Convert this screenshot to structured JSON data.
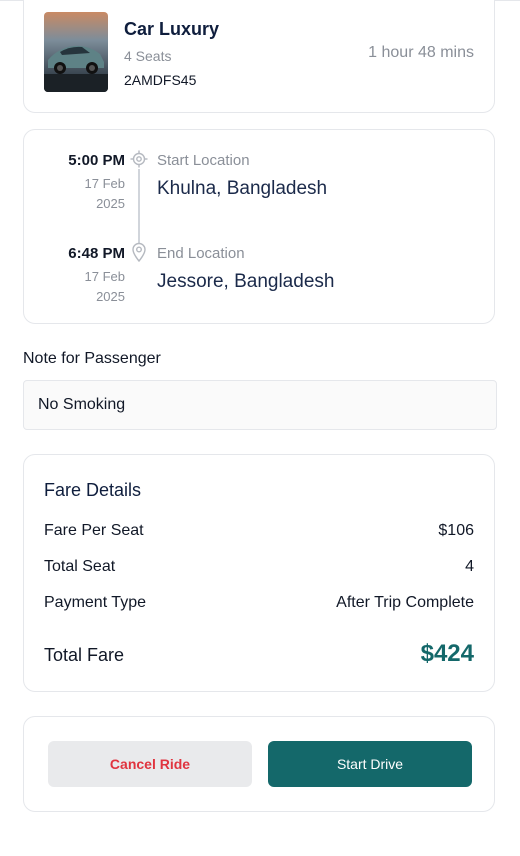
{
  "vehicle": {
    "name": "Car Luxury",
    "seats": "4 Seats",
    "plate": "2AMDFS45",
    "duration": "1 hour 48 mins"
  },
  "route": {
    "start": {
      "time": "5:00 PM",
      "date_day": "17 Feb",
      "date_year": "2025",
      "label": "Start Location",
      "value": "Khulna, Bangladesh"
    },
    "end": {
      "time": "6:48 PM",
      "date_day": "17 Feb",
      "date_year": "2025",
      "label": "End Location",
      "value": "Jessore, Bangladesh"
    }
  },
  "note": {
    "title": "Note for Passenger",
    "text": "No Smoking"
  },
  "fare": {
    "title": "Fare Details",
    "rows": [
      {
        "label": "Fare Per Seat",
        "value": "$106"
      },
      {
        "label": "Total Seat",
        "value": "4"
      },
      {
        "label": "Payment Type",
        "value": "After Trip Complete"
      }
    ],
    "total_label": "Total Fare",
    "total_value": "$424"
  },
  "actions": {
    "cancel_label": "Cancel Ride",
    "start_label": "Start Drive"
  },
  "colors": {
    "accent": "#14686a",
    "danger": "#e0343f",
    "muted": "#8a8f98"
  },
  "icons": [
    "start-location-icon",
    "end-location-icon"
  ]
}
